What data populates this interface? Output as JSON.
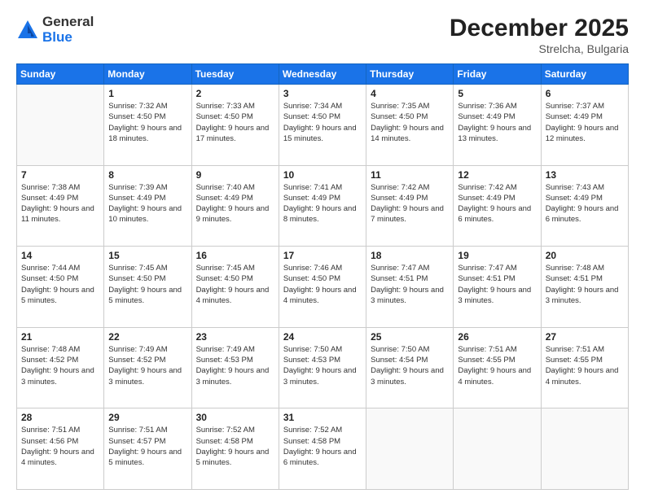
{
  "logo": {
    "general": "General",
    "blue": "Blue"
  },
  "title": "December 2025",
  "location": "Strelcha, Bulgaria",
  "days_of_week": [
    "Sunday",
    "Monday",
    "Tuesday",
    "Wednesday",
    "Thursday",
    "Friday",
    "Saturday"
  ],
  "weeks": [
    [
      {
        "day": "",
        "sunrise": "",
        "sunset": "",
        "daylight": ""
      },
      {
        "day": "1",
        "sunrise": "Sunrise: 7:32 AM",
        "sunset": "Sunset: 4:50 PM",
        "daylight": "Daylight: 9 hours and 18 minutes."
      },
      {
        "day": "2",
        "sunrise": "Sunrise: 7:33 AM",
        "sunset": "Sunset: 4:50 PM",
        "daylight": "Daylight: 9 hours and 17 minutes."
      },
      {
        "day": "3",
        "sunrise": "Sunrise: 7:34 AM",
        "sunset": "Sunset: 4:50 PM",
        "daylight": "Daylight: 9 hours and 15 minutes."
      },
      {
        "day": "4",
        "sunrise": "Sunrise: 7:35 AM",
        "sunset": "Sunset: 4:50 PM",
        "daylight": "Daylight: 9 hours and 14 minutes."
      },
      {
        "day": "5",
        "sunrise": "Sunrise: 7:36 AM",
        "sunset": "Sunset: 4:49 PM",
        "daylight": "Daylight: 9 hours and 13 minutes."
      },
      {
        "day": "6",
        "sunrise": "Sunrise: 7:37 AM",
        "sunset": "Sunset: 4:49 PM",
        "daylight": "Daylight: 9 hours and 12 minutes."
      }
    ],
    [
      {
        "day": "7",
        "sunrise": "Sunrise: 7:38 AM",
        "sunset": "Sunset: 4:49 PM",
        "daylight": "Daylight: 9 hours and 11 minutes."
      },
      {
        "day": "8",
        "sunrise": "Sunrise: 7:39 AM",
        "sunset": "Sunset: 4:49 PM",
        "daylight": "Daylight: 9 hours and 10 minutes."
      },
      {
        "day": "9",
        "sunrise": "Sunrise: 7:40 AM",
        "sunset": "Sunset: 4:49 PM",
        "daylight": "Daylight: 9 hours and 9 minutes."
      },
      {
        "day": "10",
        "sunrise": "Sunrise: 7:41 AM",
        "sunset": "Sunset: 4:49 PM",
        "daylight": "Daylight: 9 hours and 8 minutes."
      },
      {
        "day": "11",
        "sunrise": "Sunrise: 7:42 AM",
        "sunset": "Sunset: 4:49 PM",
        "daylight": "Daylight: 9 hours and 7 minutes."
      },
      {
        "day": "12",
        "sunrise": "Sunrise: 7:42 AM",
        "sunset": "Sunset: 4:49 PM",
        "daylight": "Daylight: 9 hours and 6 minutes."
      },
      {
        "day": "13",
        "sunrise": "Sunrise: 7:43 AM",
        "sunset": "Sunset: 4:49 PM",
        "daylight": "Daylight: 9 hours and 6 minutes."
      }
    ],
    [
      {
        "day": "14",
        "sunrise": "Sunrise: 7:44 AM",
        "sunset": "Sunset: 4:50 PM",
        "daylight": "Daylight: 9 hours and 5 minutes."
      },
      {
        "day": "15",
        "sunrise": "Sunrise: 7:45 AM",
        "sunset": "Sunset: 4:50 PM",
        "daylight": "Daylight: 9 hours and 5 minutes."
      },
      {
        "day": "16",
        "sunrise": "Sunrise: 7:45 AM",
        "sunset": "Sunset: 4:50 PM",
        "daylight": "Daylight: 9 hours and 4 minutes."
      },
      {
        "day": "17",
        "sunrise": "Sunrise: 7:46 AM",
        "sunset": "Sunset: 4:50 PM",
        "daylight": "Daylight: 9 hours and 4 minutes."
      },
      {
        "day": "18",
        "sunrise": "Sunrise: 7:47 AM",
        "sunset": "Sunset: 4:51 PM",
        "daylight": "Daylight: 9 hours and 3 minutes."
      },
      {
        "day": "19",
        "sunrise": "Sunrise: 7:47 AM",
        "sunset": "Sunset: 4:51 PM",
        "daylight": "Daylight: 9 hours and 3 minutes."
      },
      {
        "day": "20",
        "sunrise": "Sunrise: 7:48 AM",
        "sunset": "Sunset: 4:51 PM",
        "daylight": "Daylight: 9 hours and 3 minutes."
      }
    ],
    [
      {
        "day": "21",
        "sunrise": "Sunrise: 7:48 AM",
        "sunset": "Sunset: 4:52 PM",
        "daylight": "Daylight: 9 hours and 3 minutes."
      },
      {
        "day": "22",
        "sunrise": "Sunrise: 7:49 AM",
        "sunset": "Sunset: 4:52 PM",
        "daylight": "Daylight: 9 hours and 3 minutes."
      },
      {
        "day": "23",
        "sunrise": "Sunrise: 7:49 AM",
        "sunset": "Sunset: 4:53 PM",
        "daylight": "Daylight: 9 hours and 3 minutes."
      },
      {
        "day": "24",
        "sunrise": "Sunrise: 7:50 AM",
        "sunset": "Sunset: 4:53 PM",
        "daylight": "Daylight: 9 hours and 3 minutes."
      },
      {
        "day": "25",
        "sunrise": "Sunrise: 7:50 AM",
        "sunset": "Sunset: 4:54 PM",
        "daylight": "Daylight: 9 hours and 3 minutes."
      },
      {
        "day": "26",
        "sunrise": "Sunrise: 7:51 AM",
        "sunset": "Sunset: 4:55 PM",
        "daylight": "Daylight: 9 hours and 4 minutes."
      },
      {
        "day": "27",
        "sunrise": "Sunrise: 7:51 AM",
        "sunset": "Sunset: 4:55 PM",
        "daylight": "Daylight: 9 hours and 4 minutes."
      }
    ],
    [
      {
        "day": "28",
        "sunrise": "Sunrise: 7:51 AM",
        "sunset": "Sunset: 4:56 PM",
        "daylight": "Daylight: 9 hours and 4 minutes."
      },
      {
        "day": "29",
        "sunrise": "Sunrise: 7:51 AM",
        "sunset": "Sunset: 4:57 PM",
        "daylight": "Daylight: 9 hours and 5 minutes."
      },
      {
        "day": "30",
        "sunrise": "Sunrise: 7:52 AM",
        "sunset": "Sunset: 4:58 PM",
        "daylight": "Daylight: 9 hours and 5 minutes."
      },
      {
        "day": "31",
        "sunrise": "Sunrise: 7:52 AM",
        "sunset": "Sunset: 4:58 PM",
        "daylight": "Daylight: 9 hours and 6 minutes."
      },
      {
        "day": "",
        "sunrise": "",
        "sunset": "",
        "daylight": ""
      },
      {
        "day": "",
        "sunrise": "",
        "sunset": "",
        "daylight": ""
      },
      {
        "day": "",
        "sunrise": "",
        "sunset": "",
        "daylight": ""
      }
    ]
  ]
}
